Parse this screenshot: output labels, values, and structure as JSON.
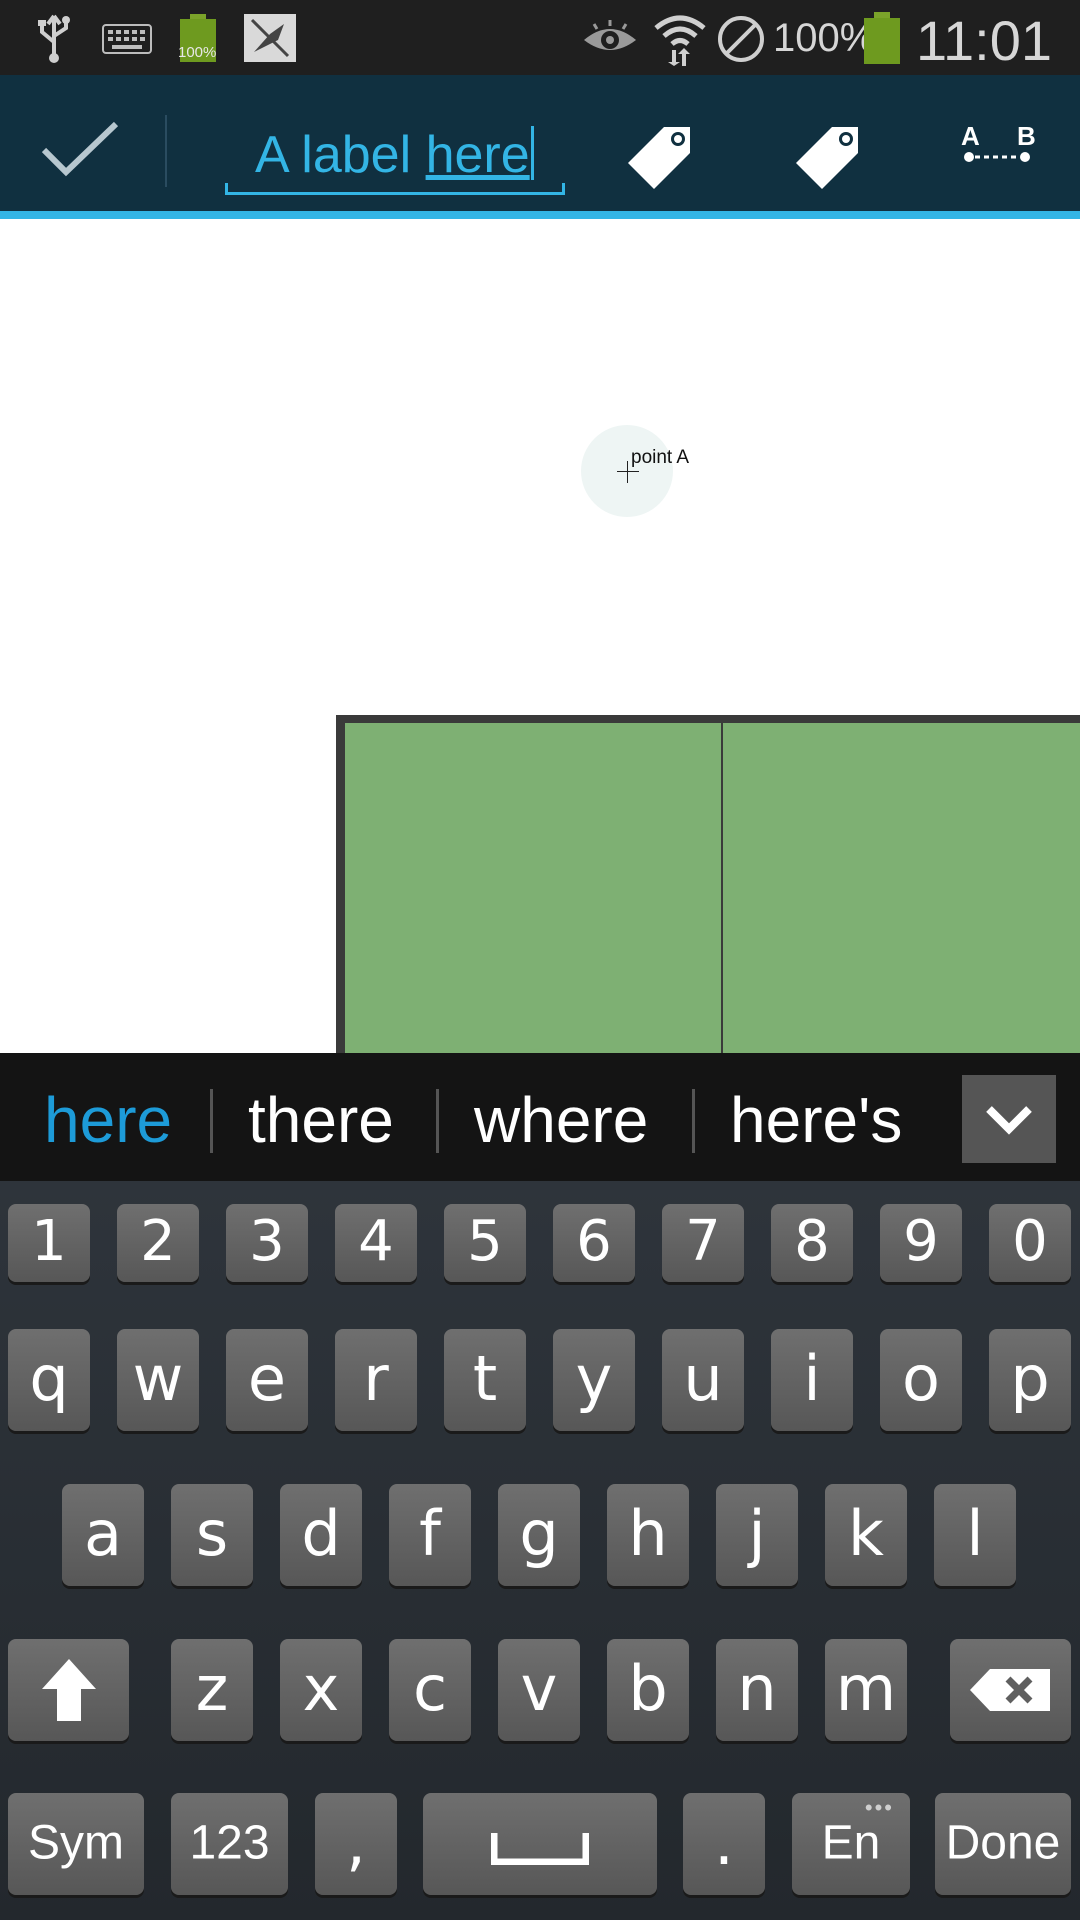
{
  "status_bar": {
    "battery_small_label": "100%",
    "battery_percent": "100%",
    "time": "11:01",
    "icons": [
      "usb-icon",
      "keyboard-icon",
      "battery-small-icon",
      "no-bird-icon",
      "eye-icon",
      "wifi-icon",
      "blocked-icon",
      "battery-icon"
    ]
  },
  "action_bar": {
    "label_text_prefix": "A label ",
    "label_text_current_word": "here",
    "buttons": [
      "done-check-icon",
      "tag-icon",
      "tag-icon",
      "segment-icon"
    ],
    "segment_label_a": "A",
    "segment_label_b": "B",
    "accent_color": "#33b5e5"
  },
  "canvas": {
    "point_label": "point A",
    "shape_color": "#7eb073"
  },
  "keyboard": {
    "suggestions": [
      "here",
      "there",
      "where",
      "here's"
    ],
    "number_row": [
      "1",
      "2",
      "3",
      "4",
      "5",
      "6",
      "7",
      "8",
      "9",
      "0"
    ],
    "row1": [
      "q",
      "w",
      "e",
      "r",
      "t",
      "y",
      "u",
      "i",
      "o",
      "p"
    ],
    "row2": [
      "a",
      "s",
      "d",
      "f",
      "g",
      "h",
      "j",
      "k",
      "l"
    ],
    "row3": [
      "z",
      "x",
      "c",
      "v",
      "b",
      "n",
      "m"
    ],
    "bottom": {
      "sym": "Sym",
      "num": "123",
      "comma": ",",
      "period": ".",
      "lang": "En",
      "lang_dots": "•••",
      "done": "Done"
    }
  }
}
